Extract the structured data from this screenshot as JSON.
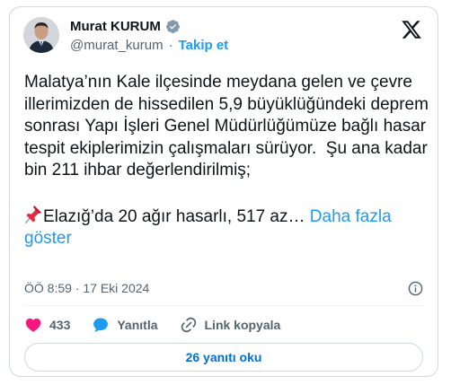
{
  "author": {
    "name": "Murat KURUM",
    "handle": "@murat_kurum",
    "separator": "·",
    "follow_label": "Takip et"
  },
  "tweet": {
    "text": "Malatya’nın Kale ilçesinde meydana gelen ve çevre illerimizden de hissedilen 5,9 büyüklüğündeki deprem sonrası Yapı İşleri Genel Müdürlüğümüze bağlı hasar tespit ekiplerimizin çalışmaları sürüyor.  Şu ana kadar bin 211 ihbar değerlendirilmiş;",
    "second_line": "Elazığ’da 20 ağır hasarlı, 517 az…",
    "show_more_label": "Daha fazla göster",
    "timestamp": "ÖÖ 8:59 · 17 Eki 2024"
  },
  "actions": {
    "like_count": "433",
    "reply_label": "Yanıtla",
    "copy_link_label": "Link kopyala"
  },
  "replies_button_label": "26 yanıtı oku",
  "colors": {
    "accent": "#1d9bf0",
    "like": "#f91880",
    "muted": "#536471",
    "text": "#0f1419"
  },
  "icons": [
    "verified-badge-icon",
    "x-logo-icon",
    "pushpin-icon",
    "info-icon",
    "heart-icon",
    "reply-bubble-icon",
    "link-icon"
  ]
}
